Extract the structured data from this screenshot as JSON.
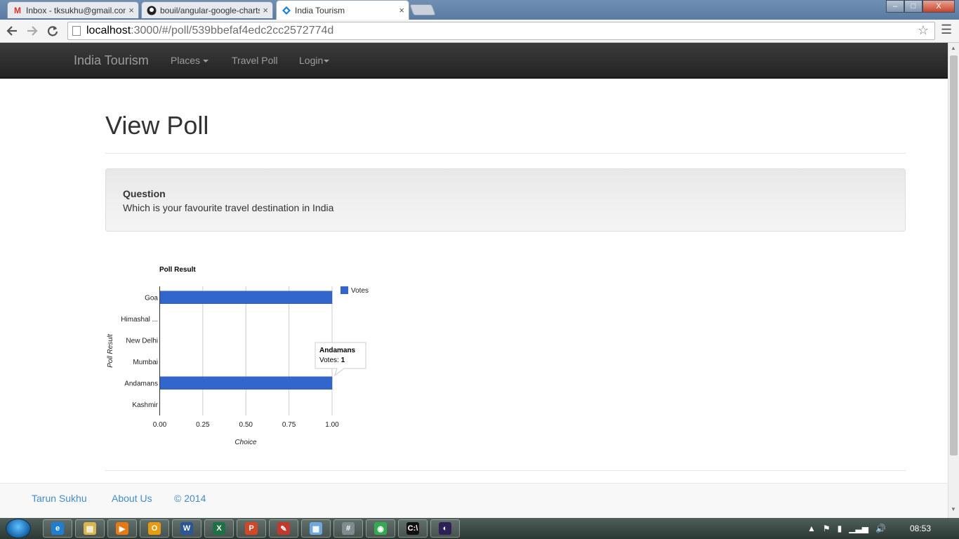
{
  "browser": {
    "tabs": [
      {
        "title": "Inbox - tksukhu@gmail.com",
        "icon": "gmail-icon"
      },
      {
        "title": "bouil/angular-google-charts",
        "icon": "github-icon"
      },
      {
        "title": "India Tourism",
        "icon": "angular-icon"
      }
    ],
    "tab_close_glyph": "×",
    "url_host": "localhost",
    "url_path": ":3000/#/poll/539bbefaf4edc2cc2572774d",
    "window_buttons": {
      "minimize": "–",
      "maximize": "□",
      "close": "X"
    }
  },
  "navbar": {
    "brand": "India Tourism",
    "places": "Places",
    "travel_poll": "Travel Poll",
    "login": "Login"
  },
  "page": {
    "title": "View Poll",
    "question_label": "Question",
    "question_text": "Which is your favourite travel destination in India"
  },
  "chart_data": {
    "type": "bar",
    "orientation": "horizontal",
    "title": "Poll Result",
    "xlabel": "Choice",
    "ylabel": "Poll Result",
    "categories": [
      "Goa",
      "Himashal ...",
      "New Delhi",
      "Mumbai",
      "Andamans",
      "Kashmir"
    ],
    "series": [
      {
        "name": "Votes",
        "values": [
          1,
          0,
          0,
          0,
          1,
          0
        ],
        "color": "#3366cc"
      }
    ],
    "xlim": [
      0,
      1
    ],
    "xticks": [
      "0.00",
      "0.25",
      "0.50",
      "0.75",
      "1.00"
    ],
    "grid": true,
    "legend": "right",
    "tooltip": {
      "title": "Andamans",
      "label": "Votes: ",
      "value": "1"
    }
  },
  "footer": {
    "author": "Tarun Sukhu",
    "about": "About Us",
    "copyright": "© 2014"
  },
  "taskbar": {
    "apps": [
      {
        "name": "internet-explorer",
        "glyph": "e",
        "color": "#1e7fd1"
      },
      {
        "name": "file-explorer",
        "glyph": "▤",
        "color": "#d9b650"
      },
      {
        "name": "media-player",
        "glyph": "▶",
        "color": "#e57a13"
      },
      {
        "name": "outlook",
        "glyph": "O",
        "color": "#e59c13"
      },
      {
        "name": "word",
        "glyph": "W",
        "color": "#2b5797"
      },
      {
        "name": "excel",
        "glyph": "X",
        "color": "#1e7145"
      },
      {
        "name": "powerpoint",
        "glyph": "P",
        "color": "#d24726"
      },
      {
        "name": "paint",
        "glyph": "✎",
        "color": "#c0392b"
      },
      {
        "name": "remote-desktop",
        "glyph": "▦",
        "color": "#6fa8dc"
      },
      {
        "name": "calculator",
        "glyph": "#",
        "color": "#7f8c8d"
      },
      {
        "name": "chrome",
        "glyph": "◉",
        "color": "#34a853"
      },
      {
        "name": "command-prompt",
        "glyph": "C:\\",
        "color": "#111"
      },
      {
        "name": "eclipse",
        "glyph": "◐",
        "color": "#2c2255"
      }
    ],
    "clock": "08:53"
  }
}
